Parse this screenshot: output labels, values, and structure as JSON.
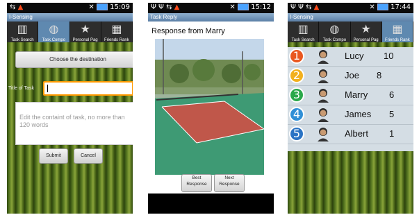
{
  "phone1": {
    "status": {
      "time": "15:09"
    },
    "app_title": "I-Sensing",
    "tabs": [
      {
        "label": "Task Search",
        "icon": "building-icon"
      },
      {
        "label": "Task Compo",
        "icon": "tennis-icon"
      },
      {
        "label": "Personal Pag",
        "icon": "star-icon"
      },
      {
        "label": "Friends Rank",
        "icon": "ranking-icon"
      }
    ],
    "destination_button": "Choose the destination",
    "title_label": "Title of Task",
    "title_value": "",
    "content_placeholder": "Edit the containt of task, no more than 120 words",
    "submit_label": "Submit",
    "cancel_label": "Cancel"
  },
  "phone2": {
    "status": {
      "time": "15:12"
    },
    "app_title": "Task Reply",
    "response_title": "Response from Marry",
    "best_line1": "Best",
    "best_line2": "Response",
    "next_line1": "Next",
    "next_line2": "Response"
  },
  "phone3": {
    "status": {
      "time": "17:44"
    },
    "app_title": "I-Sensing",
    "tabs": [
      {
        "label": "Task Search",
        "icon": "building-icon"
      },
      {
        "label": "Task Compo",
        "icon": "tennis-icon"
      },
      {
        "label": "Personal Pag",
        "icon": "star-icon"
      },
      {
        "label": "Friends Rank",
        "icon": "ranking-icon"
      }
    ],
    "ranking": [
      {
        "rank": "1",
        "name": "Lucy",
        "score": "10",
        "color": "#e9571f"
      },
      {
        "rank": "2",
        "name": "Joe",
        "score": "8",
        "color": "#f2b01e"
      },
      {
        "rank": "3",
        "name": "Marry",
        "score": "6",
        "color": "#2aa84a"
      },
      {
        "rank": "4",
        "name": "James",
        "score": "5",
        "color": "#2f8fd6"
      },
      {
        "rank": "5",
        "name": "Albert",
        "score": "1",
        "color": "#2a73c4"
      }
    ]
  }
}
